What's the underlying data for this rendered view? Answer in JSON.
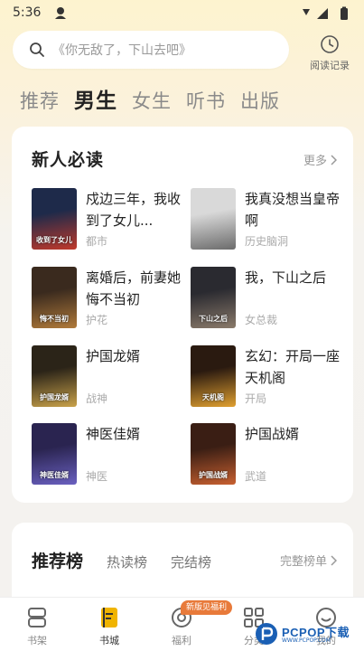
{
  "status": {
    "time": "5:36"
  },
  "search": {
    "placeholder": "《你无敌了，下山去吧》"
  },
  "history": {
    "label": "阅读记录"
  },
  "tabs": [
    "推荐",
    "男生",
    "女生",
    "听书",
    "出版"
  ],
  "section": {
    "title": "新人必读",
    "more": "更多"
  },
  "books": [
    {
      "title": "戍边三年，我收到了女儿...",
      "tag": "都市",
      "cover": [
        "#1e2a4a",
        "#c0392b"
      ],
      "cover_text": "收到了女儿"
    },
    {
      "title": "我真没想当皇帝啊",
      "tag": "历史脑洞",
      "cover": [
        "#d9d9d9",
        "#6b6b6b"
      ],
      "cover_text": ""
    },
    {
      "title": "离婚后，前妻她悔不当初",
      "tag": "护花",
      "cover": [
        "#3a2a1e",
        "#b07a3a"
      ],
      "cover_text": "悔不当初"
    },
    {
      "title": "我，下山之后",
      "tag": "女总裁",
      "cover": [
        "#2a2a30",
        "#8a7a6a"
      ],
      "cover_text": "下山之后"
    },
    {
      "title": "护国龙婿",
      "tag": "战神",
      "cover": [
        "#2b2418",
        "#c9a24a"
      ],
      "cover_text": "护国龙婿"
    },
    {
      "title": "玄幻：开局一座天机阁",
      "tag": "开局",
      "cover": [
        "#2a1a10",
        "#e0a030"
      ],
      "cover_text": "天机阁"
    },
    {
      "title": "神医佳婿",
      "tag": "神医",
      "cover": [
        "#2a2450",
        "#6a60c0"
      ],
      "cover_text": "神医佳婿"
    },
    {
      "title": "护国战婿",
      "tag": "武道",
      "cover": [
        "#3a1e14",
        "#c86030"
      ],
      "cover_text": "护国战婿"
    }
  ],
  "rank": {
    "tabs": [
      "推荐榜",
      "热读榜",
      "完结榜"
    ],
    "more": "完整榜单"
  },
  "nav": {
    "items": [
      "书架",
      "书城",
      "福利",
      "分类",
      "我的"
    ],
    "badge": "新版见福利"
  },
  "watermark": {
    "text": "PCPOP下载",
    "sub": "WWW.PCPOP.COM"
  },
  "colors": {
    "accent": "#f0b400",
    "background": "#f4f2ef"
  }
}
